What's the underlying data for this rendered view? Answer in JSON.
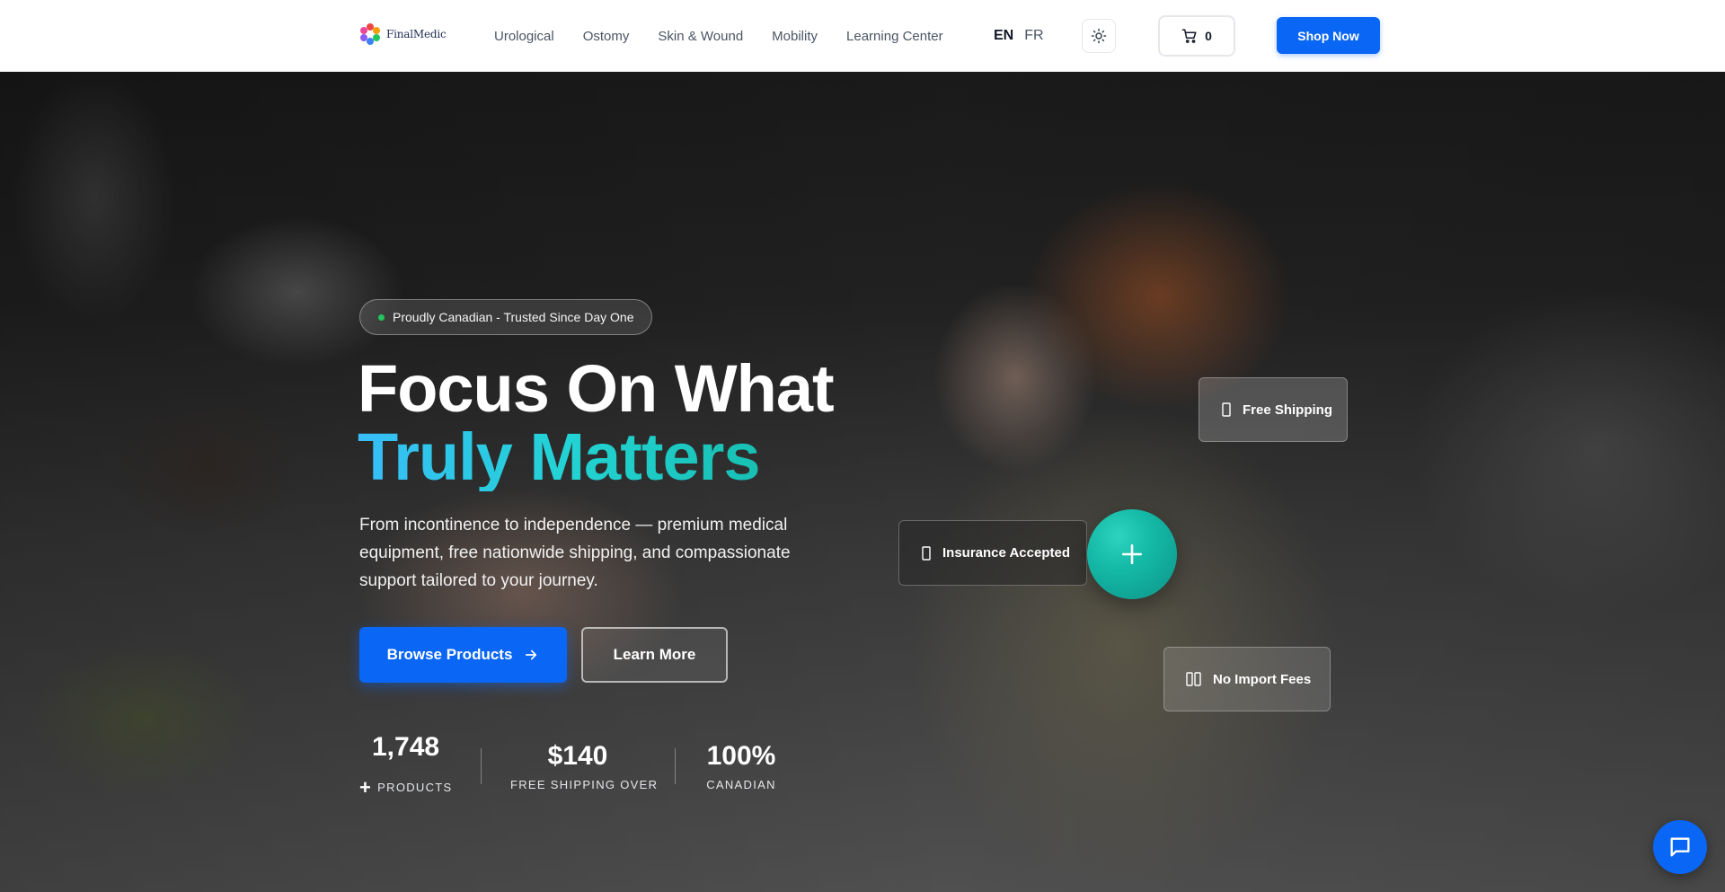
{
  "header": {
    "logo_text": "FinalMedic",
    "nav": [
      {
        "label": "Urological"
      },
      {
        "label": "Ostomy"
      },
      {
        "label": "Skin & Wound"
      },
      {
        "label": "Mobility"
      },
      {
        "label": "Learning Center"
      }
    ],
    "lang_en": "EN",
    "lang_fr": "FR",
    "theme_icon": "sun-icon",
    "cart_icon": "cart-icon",
    "cart_count": "0",
    "shop_now_label": "Shop Now"
  },
  "hero": {
    "badge": "Proudly Canadian - Trusted Since Day One",
    "title_line1": "Focus On What",
    "title_line2": "Truly Matters",
    "description": "From incontinence to independence — premium medical equipment, free nationwide shipping, and compassionate support tailored to your journey.",
    "browse_label": "Browse Products",
    "learn_label": "Learn More",
    "stats": [
      {
        "value": "1,748",
        "label": "PRODUCTS"
      },
      {
        "value": "$140",
        "label": "FREE SHIPPING OVER"
      },
      {
        "value": "100%",
        "label": "CANADIAN"
      }
    ],
    "cards": {
      "shipping": "Free Shipping",
      "insurance": "Insurance Accepted",
      "import": "No Import Fees"
    }
  },
  "colors": {
    "brand_blue": "#0a66f5",
    "accent_teal": "#14b8a6",
    "accent_sky": "#38bdf8"
  }
}
